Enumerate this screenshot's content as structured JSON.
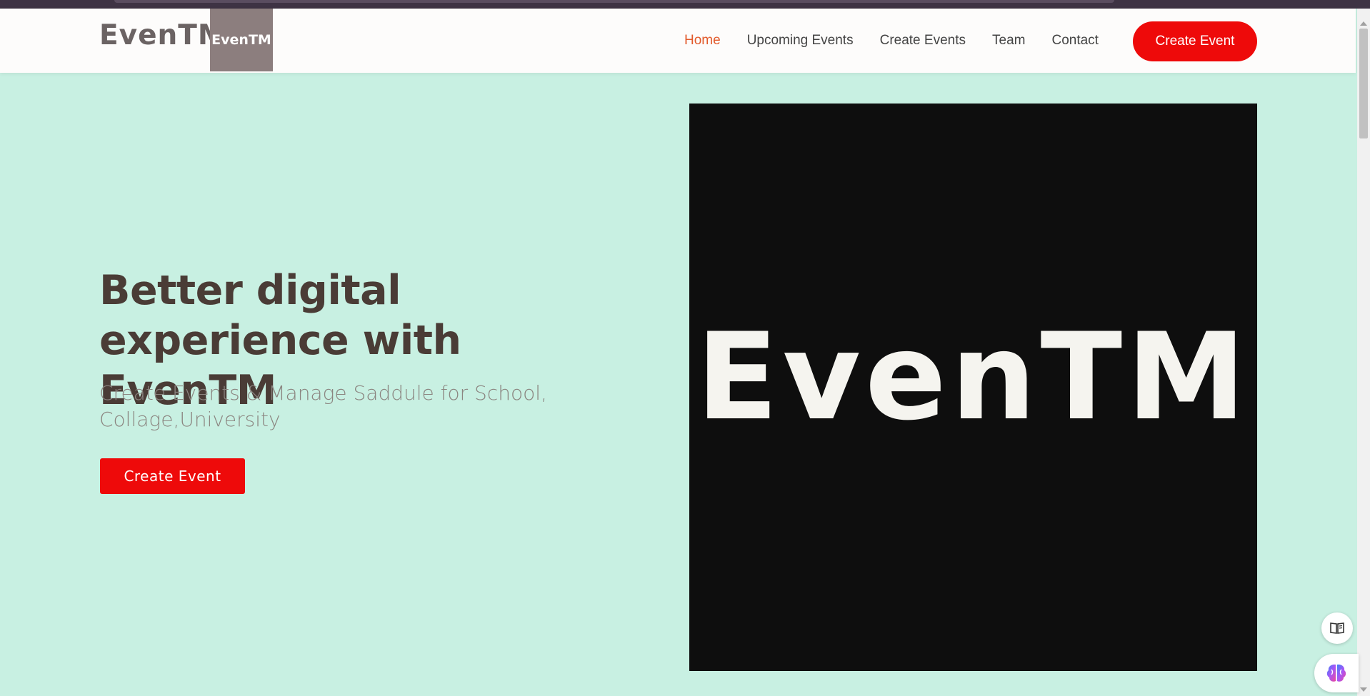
{
  "navbar": {
    "brand_text": "EvenTM",
    "brand_logo_text": "EvenTM",
    "links": [
      {
        "label": "Home",
        "active": true
      },
      {
        "label": "Upcoming Events",
        "active": false
      },
      {
        "label": "Create Events",
        "active": false
      },
      {
        "label": "Team",
        "active": false
      },
      {
        "label": "Contact",
        "active": false
      }
    ],
    "cta_label": "Create Event"
  },
  "hero": {
    "title": "Better digital experience with EvenTM",
    "subtitle": "Create Events & Manage Saddule for School, Collage,University",
    "cta_label": "Create Event",
    "image_text": "EvenTM"
  },
  "floating": {
    "reader_icon": "book-open-icon",
    "assistant_icon": "brain-icon"
  },
  "colors": {
    "background": "#c8f0e2",
    "accent_red": "#ee0a0a",
    "active_link": "#e25a2b",
    "heading": "#4a3c36",
    "logo_bg": "#8c7e7e"
  }
}
